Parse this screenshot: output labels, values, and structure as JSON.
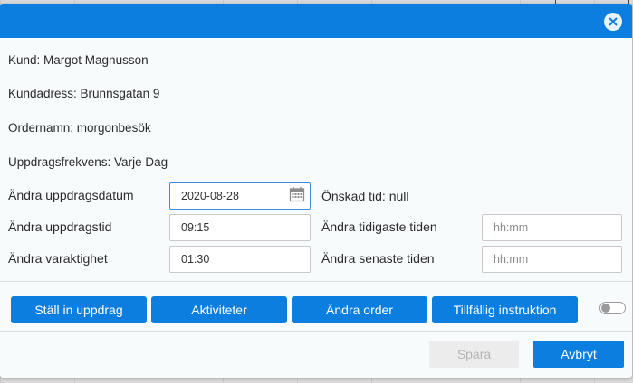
{
  "customer": {
    "name_line": "Kund: Margot Magnusson",
    "address_line": "Kundadress: Brunnsgatan 9"
  },
  "order": {
    "name_line": "Ordernamn: morgonbesök",
    "frequency_line": "Uppdragsfrekvens: Varje Dag"
  },
  "form": {
    "date_label": "Ändra uppdragsdatum",
    "date_value": "2020-08-28",
    "desired_time_label": "Önskad tid: null",
    "time_label": "Ändra uppdragstid",
    "time_value": "09:15",
    "earliest_label": "Ändra tidigaste tiden",
    "earliest_placeholder": "hh:mm",
    "duration_label": "Ändra varaktighet",
    "duration_value": "01:30",
    "latest_label": "Ändra senaste tiden",
    "latest_placeholder": "hh:mm"
  },
  "actions": {
    "cancel_assignment": "Ställ in uppdrag",
    "activities": "Aktiviteter",
    "change_order": "Ändra order",
    "temporary_instruction": "Tillfällig instruktion",
    "toggle_on": false
  },
  "footer": {
    "save": "Spara",
    "cancel": "Avbryt"
  },
  "icons": {
    "close": "close-icon",
    "calendar": "calendar-icon"
  },
  "colors": {
    "accent": "#0b7ee0",
    "disabled_bg": "#ececec",
    "disabled_text": "#b4b4b4"
  }
}
